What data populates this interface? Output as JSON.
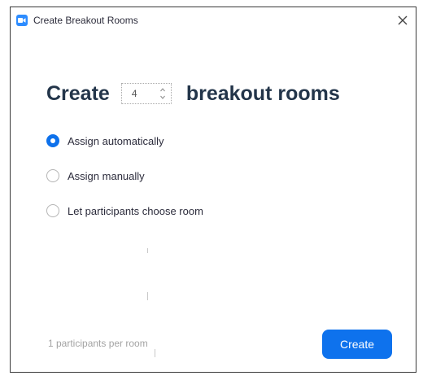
{
  "window": {
    "title": "Create Breakout Rooms"
  },
  "heading": {
    "prefix": "Create",
    "count": "4",
    "suffix": "breakout rooms"
  },
  "options": [
    {
      "label": "Assign automatically",
      "selected": true
    },
    {
      "label": "Assign manually",
      "selected": false
    },
    {
      "label": "Let participants choose room",
      "selected": false
    }
  ],
  "footer": {
    "note": "1 participants per room",
    "create_label": "Create"
  },
  "icons": {
    "app": "zoom-camera-icon",
    "close": "close-icon",
    "stepper": "stepper-arrows-icon"
  },
  "colors": {
    "accent": "#0e72ed",
    "heading": "#23354a"
  }
}
